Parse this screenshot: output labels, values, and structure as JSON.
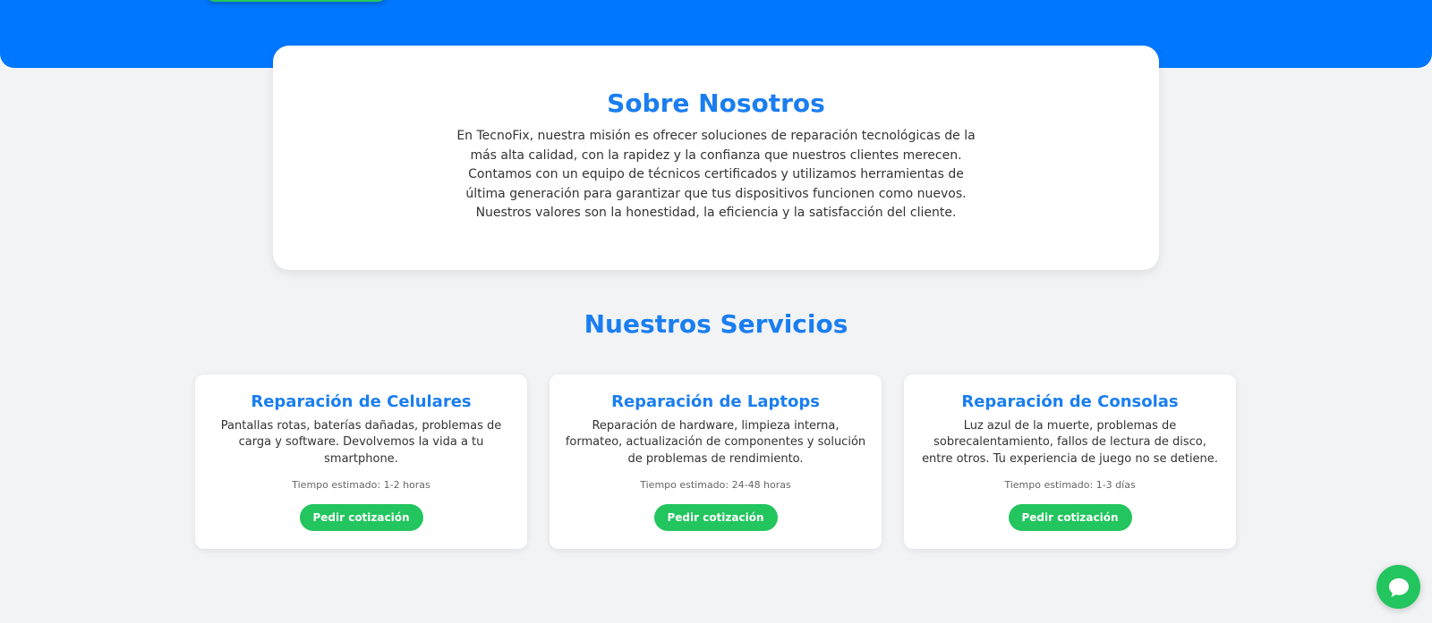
{
  "about": {
    "title": "Sobre Nosotros",
    "text": "En TecnoFix, nuestra misión es ofrecer soluciones de reparación tecnológicas de la más alta calidad, con la rapidez y la confianza que nuestros clientes merecen. Contamos con un equipo de técnicos certificados y utilizamos herramientas de última generación para garantizar que tus dispositivos funcionen como nuevos. Nuestros valores son la honestidad, la eficiencia y la satisfacción del cliente."
  },
  "services": {
    "title": "Nuestros Servicios",
    "items": [
      {
        "title": "Reparación de Celulares",
        "description": "Pantallas rotas, baterías dañadas, problemas de carga y software. Devolvemos la vida a tu smartphone.",
        "time": "Tiempo estimado: 1-2 horas",
        "button": "Pedir cotización"
      },
      {
        "title": "Reparación de Laptops",
        "description": "Reparación de hardware, limpieza interna, formateo, actualización de componentes y solución de problemas de rendimiento.",
        "time": "Tiempo estimado: 24-48 horas",
        "button": "Pedir cotización"
      },
      {
        "title": "Reparación de Consolas",
        "description": "Luz azul de la muerte, problemas de sobrecalentamiento, fallos de lectura de disco, entre otros. Tu experiencia de juego no se detiene.",
        "time": "Tiempo estimado: 1-3 días",
        "button": "Pedir cotización"
      }
    ]
  },
  "chat": {
    "icon": "chat-bubble-icon"
  },
  "colors": {
    "hero": "#0077ff",
    "heading": "#1a7ef0",
    "accent": "#22c55e",
    "background": "#f2f3f5"
  }
}
